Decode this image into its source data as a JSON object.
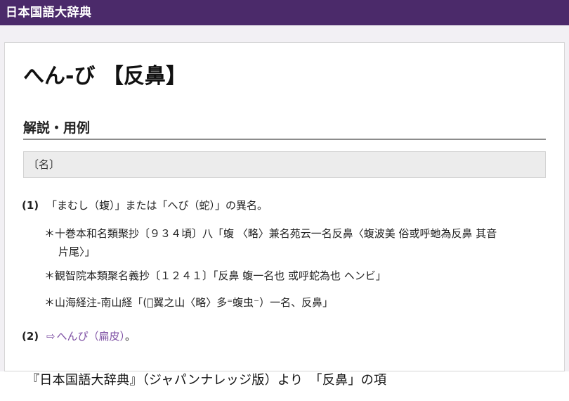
{
  "header": {
    "site_title": "日本国語大辞典"
  },
  "entry": {
    "title": "へん-び 【反鼻】",
    "section_heading": "解説・用例",
    "part_of_speech": "〔名〕",
    "definitions": [
      {
        "number": "(1)",
        "text": "「まむし（蝮）」または「へび（蛇）」の異名。"
      },
      {
        "number": "(2)",
        "arrow": "⇨",
        "link_text": "へんぴ（扁皮）",
        "trailing": "。"
      }
    ],
    "citations": [
      {
        "line1": "＊十巻本和名類聚抄〔９３４頃〕八「蝮 〈略〉兼名苑云一名反鼻〈蝮波美 俗或呼虵為反鼻 其音",
        "line2": "片尾〉」"
      },
      {
        "line1": "＊観智院本類聚名義抄〔１２４１〕「反鼻 蝮一名也 或呼蛇為也 ヘンビ」"
      },
      {
        "line1": "＊山海経注-南山経「(𤼵翼之山〈略〉多⁼蝮虫⁻）一名、反鼻」"
      }
    ]
  },
  "caption": "『日本国語大辞典』（ジャパンナレッジ版）より　「反鼻」の項"
}
